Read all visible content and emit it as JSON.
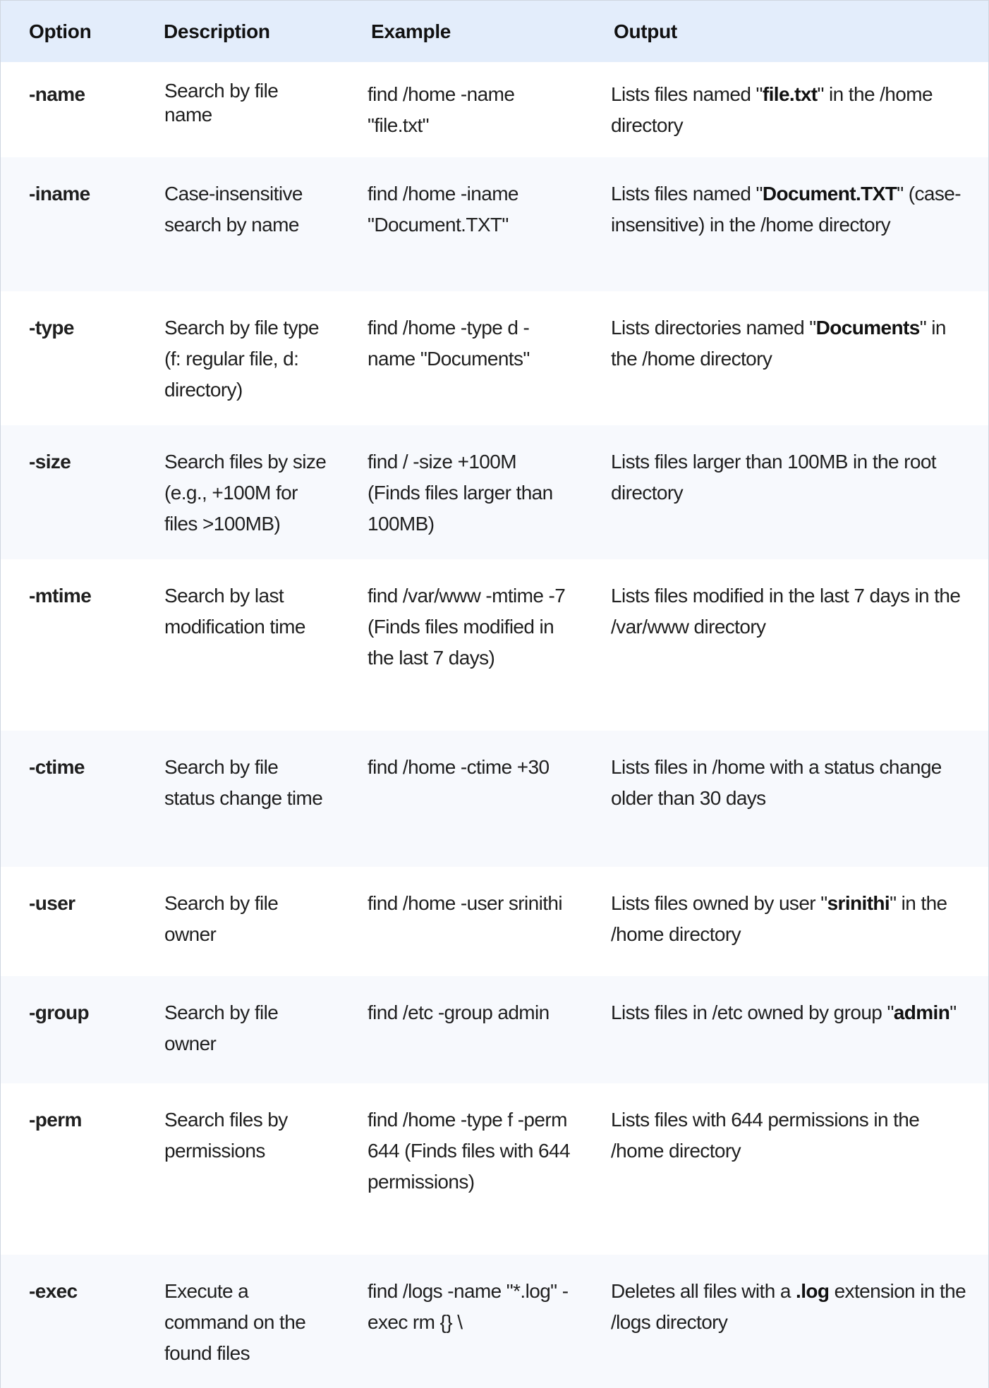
{
  "table": {
    "headers": {
      "option": "Option",
      "description": "Description",
      "example": "Example",
      "output": "Output"
    },
    "rows": [
      {
        "option": "-name",
        "description": "Search by file name",
        "example": "find /home -name \"file.txt\"",
        "output": {
          "before": "Lists files named \"",
          "bold": "file.txt",
          "after": "\" in the /home directory"
        }
      },
      {
        "option": "-iname",
        "description": "Case-insensitive search by name",
        "example": "find /home -iname \"Document.TXT\"",
        "output": {
          "before": "Lists files named \"",
          "bold": "Document.TXT",
          "after": "\" (case-insensitive) in the /home directory"
        }
      },
      {
        "option": "-type",
        "description": "Search by file type (f: regular file, d: directory)",
        "example": "find /home -type d -name \"Documents\"",
        "output": {
          "before": "Lists directories named \"",
          "bold": "Documents",
          "after": "\" in the /home directory"
        }
      },
      {
        "option": "-size",
        "description": "Search files by size (e.g., +100M for files >100MB)",
        "example": "find / -size +100M (Finds files larger than 100MB)",
        "output": {
          "before": "Lists files larger than 100MB in the root directory",
          "bold": "",
          "after": ""
        }
      },
      {
        "option": "-mtime",
        "description": "Search by last modification time",
        "example": "find /var/www -mtime -7 (Finds files modified in the last 7 days)",
        "output": {
          "before": "Lists files modified in the last 7 days in the /var/www directory",
          "bold": "",
          "after": ""
        }
      },
      {
        "option": "-ctime",
        "description": "Search by file status change time",
        "example": "find /home -ctime +30",
        "output": {
          "before": "Lists files in /home with a status change older than 30 days",
          "bold": "",
          "after": ""
        }
      },
      {
        "option": "-user",
        "description": "Search by file owner",
        "example": "find /home -user srinithi",
        "output": {
          "before": "Lists files owned by user \"",
          "bold": "srinithi",
          "after": "\" in the /home directory"
        }
      },
      {
        "option": "-group",
        "description": "Search by file owner",
        "example": "find /etc -group admin",
        "output": {
          "before": "Lists files in /etc owned by group \"",
          "bold": "admin",
          "after": "\""
        }
      },
      {
        "option": "-perm",
        "description": "Search files by permissions",
        "example": "find /home -type f -perm 644 (Finds files with 644 permissions)",
        "output": {
          "before": "Lists files with 644 permissions in the /home directory",
          "bold": "",
          "after": ""
        }
      },
      {
        "option": "-exec",
        "description": "Execute a command on the found files",
        "example": "find /logs -name \"*.log\" -exec rm {} \\",
        "output": {
          "before": "Deletes all files with a ",
          "bold": ".log",
          "after": " extension in the /logs directory"
        }
      }
    ]
  },
  "colors": {
    "header_bg": "#e3edfb",
    "row_alt_bg": "#f7f9fd",
    "row_bg": "#ffffff",
    "border": "#cfd6e0",
    "text": "#1f1f1f"
  }
}
